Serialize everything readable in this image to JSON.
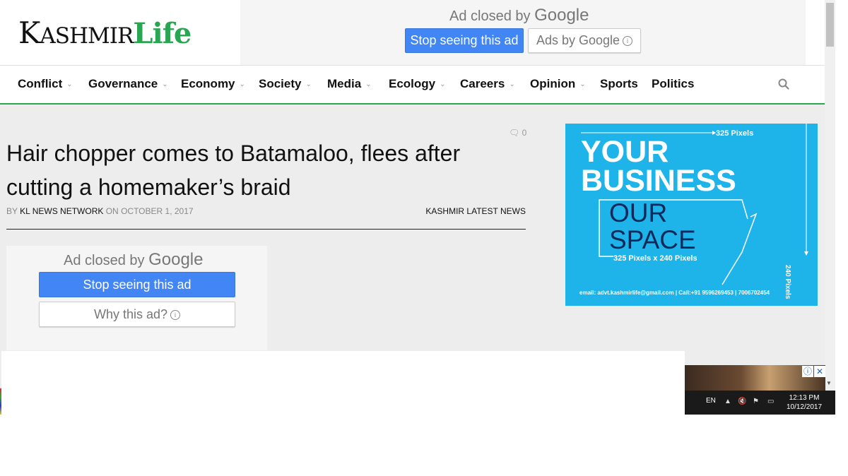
{
  "site": {
    "logo_part1": "K",
    "logo_part2": "ASHMIR",
    "logo_part3": "Life"
  },
  "top_ad": {
    "closed_text": "Ad closed by",
    "google": "Google",
    "stop_button": "Stop seeing this ad",
    "ads_by_button": "Ads by Google"
  },
  "nav": {
    "items": [
      {
        "label": "Conflict",
        "dropdown": true
      },
      {
        "label": "Governance",
        "dropdown": true
      },
      {
        "label": "Economy",
        "dropdown": true
      },
      {
        "label": "Society",
        "dropdown": true
      },
      {
        "label": "Media",
        "dropdown": true
      },
      {
        "label": "Ecology",
        "dropdown": true
      },
      {
        "label": "Careers",
        "dropdown": true
      },
      {
        "label": "Opinion",
        "dropdown": true
      },
      {
        "label": "Sports",
        "dropdown": false
      },
      {
        "label": "Politics",
        "dropdown": false
      }
    ],
    "search_icon": "search-icon",
    "accent_color": "#2aa551"
  },
  "article": {
    "title": "Hair chopper comes to Batamaloo, flees after cutting a homemaker’s braid",
    "comment_count": "0",
    "by": "BY",
    "author": "KL NEWS NETWORK",
    "on": "ON",
    "date": "OCTOBER 1, 2017",
    "category": "KASHMIR LATEST NEWS"
  },
  "inline_ad": {
    "closed_text": "Ad closed by",
    "google": "Google",
    "stop_button": "Stop seeing this ad",
    "why_button": "Why this ad?"
  },
  "side_ad": {
    "width_label": "325 Pixels",
    "headline_1": "YOUR",
    "headline_2": "BUSINESS",
    "sub_1": "OUR",
    "sub_2": "SPACE",
    "dims": "325 Pixels x 240 Pixels",
    "height_label": "240 Pixels",
    "contact": "email: advt.kashmirlife@gmail.com  |  Call:+91 9596269453  |  7006702454",
    "bg_color": "#1eb4ea"
  },
  "taskbar": {
    "lang": "EN",
    "time": "12:13 PM",
    "date": "10/12/2017"
  }
}
